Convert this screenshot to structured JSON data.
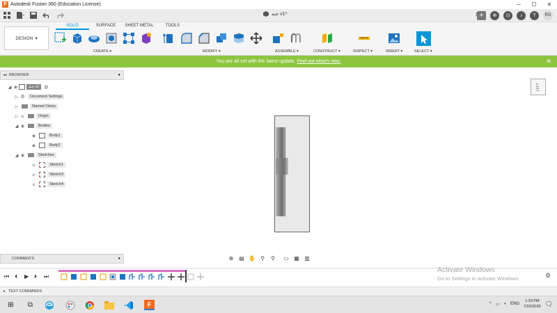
{
  "window": {
    "title": "Autodesk Fusion 360 (Education License)",
    "app_logo": "F",
    "minimize_glyph": "─",
    "maximize_glyph": "☐",
    "close_glyph": "✕"
  },
  "quick_access": {
    "document_tab": "جنه v1*",
    "close_tab_glyph": "✕",
    "add_tab_glyph": "+",
    "help_glyph": "?",
    "user_initials": "RG"
  },
  "ribbon": {
    "workspace_label": "DESIGN",
    "workspace_dropdown_glyph": "▾",
    "tabs": [
      "SOLID",
      "SURFACE",
      "SHEET METAL",
      "TOOLS"
    ],
    "active_tab": "SOLID",
    "groups": [
      "CREATE ▾",
      "MODIFY ▾",
      "ASSEMBLE ▾",
      "CONSTRUCT ▾",
      "INSPECT ▾",
      "INSERT ▾",
      "SELECT ▾"
    ]
  },
  "banner": {
    "message": "You are all set with the latest update.",
    "link": "Find out what's new.",
    "close_glyph": "✕"
  },
  "browser": {
    "title": "BROWSER",
    "collapse_glyph": "◂◂",
    "pin_glyph": "●",
    "items": [
      {
        "label": "جنه v1",
        "expand": "◢"
      },
      {
        "label": "Document Settings",
        "expand": "▷"
      },
      {
        "label": "Named Views",
        "expand": "▷"
      },
      {
        "label": "Origin",
        "expand": "▷"
      },
      {
        "label": "Bodies",
        "expand": "◢"
      },
      {
        "label": "Body1",
        "expand": ""
      },
      {
        "label": "Body2",
        "expand": ""
      },
      {
        "label": "Sketches",
        "expand": "◢"
      },
      {
        "label": "Sketch1",
        "expand": ""
      },
      {
        "label": "Sketch3",
        "expand": ""
      },
      {
        "label": "Sketch4",
        "expand": ""
      }
    ]
  },
  "viewcube": {
    "face": "LEFT"
  },
  "comments": {
    "title": "COMMENTS",
    "pin_glyph": "●"
  },
  "timeline": {
    "first_glyph": "⏮",
    "prev_glyph": "◀",
    "play_glyph": "▶",
    "next_glyph": "▶",
    "last_glyph": "⏭",
    "settings_glyph": "⚙"
  },
  "watermark": {
    "title": "Activate Windows",
    "subtitle": "Go to Settings to activate Windows."
  },
  "text_commands": {
    "label": "TEXT COMMANDS",
    "toggle_glyph": "●"
  },
  "taskbar": {
    "start_glyph": "⊞",
    "tray_up_glyph": "^",
    "language": "ENG",
    "time": "1:33 PM",
    "date": "7/22/2020",
    "notification_glyph": "🗨"
  },
  "colors": {
    "accent": "#0696d7",
    "banner": "#8cc63f",
    "timeline_track": "#d772c4",
    "app_brand": "#f26b21"
  }
}
